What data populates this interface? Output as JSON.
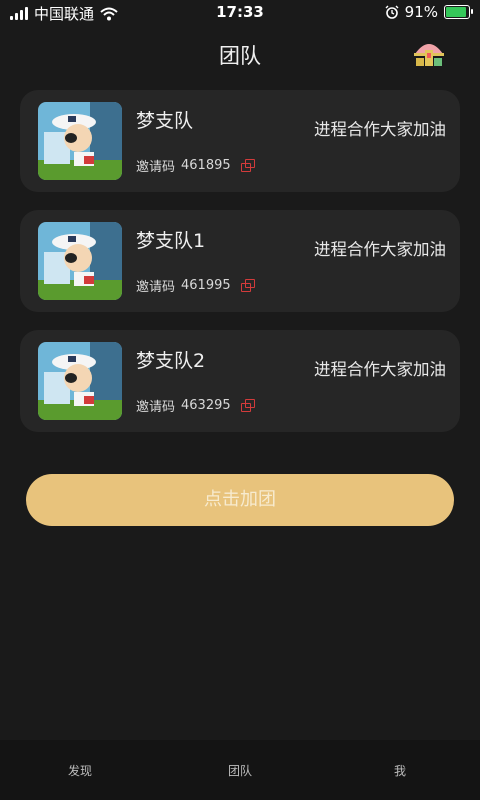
{
  "status_bar": {
    "carrier": "中国联通",
    "time": "17:33",
    "battery_percent": "91%",
    "battery_level": 0.91,
    "icons": [
      "signal-icon",
      "wifi-icon",
      "alarm-icon",
      "battery-icon"
    ]
  },
  "header": {
    "title": "团队",
    "right_icon": "ranking-podium-icon"
  },
  "teams": [
    {
      "name": "梦支队",
      "invite_label": "邀请码",
      "invite_code": "461895",
      "slogan": "进程合作大家加油"
    },
    {
      "name": "梦支队1",
      "invite_label": "邀请码",
      "invite_code": "461995",
      "slogan": "进程合作大家加油"
    },
    {
      "name": "梦支队2",
      "invite_label": "邀请码",
      "invite_code": "463295",
      "slogan": "进程合作大家加油"
    }
  ],
  "join_button": {
    "label": "点击加团"
  },
  "tab_bar": {
    "tabs": [
      {
        "label": "发现"
      },
      {
        "label": "团队"
      },
      {
        "label": "我"
      }
    ]
  },
  "colors": {
    "background": "#1a1a1a",
    "card": "#262626",
    "accent": "#e8c37c",
    "copy_icon": "#d23b3b"
  }
}
